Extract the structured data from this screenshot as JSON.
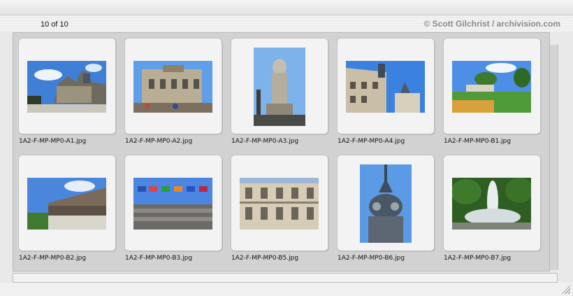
{
  "header": {
    "counter": "10 of 10",
    "credit": "© Scott Gilchrist / archivision.com"
  },
  "thumbnails": [
    {
      "filename": "1A2-F-MP-MP0-A1.jpg"
    },
    {
      "filename": "1A2-F-MP-MP0-A2.jpg"
    },
    {
      "filename": "1A2-F-MP-MP0-A3.jpg"
    },
    {
      "filename": "1A2-F-MP-MP0-A4.jpg"
    },
    {
      "filename": "1A2-F-MP-MP0-B1.jpg"
    },
    {
      "filename": "1A2-F-MP-MP0-B2.jpg"
    },
    {
      "filename": "1A2-F-MP-MP0-B3.jpg"
    },
    {
      "filename": "1A2-F-MP-MP0-B5.jpg"
    },
    {
      "filename": "1A2-F-MP-MP0-B6.jpg"
    },
    {
      "filename": "1A2-F-MP-MP0-B7.jpg"
    }
  ]
}
